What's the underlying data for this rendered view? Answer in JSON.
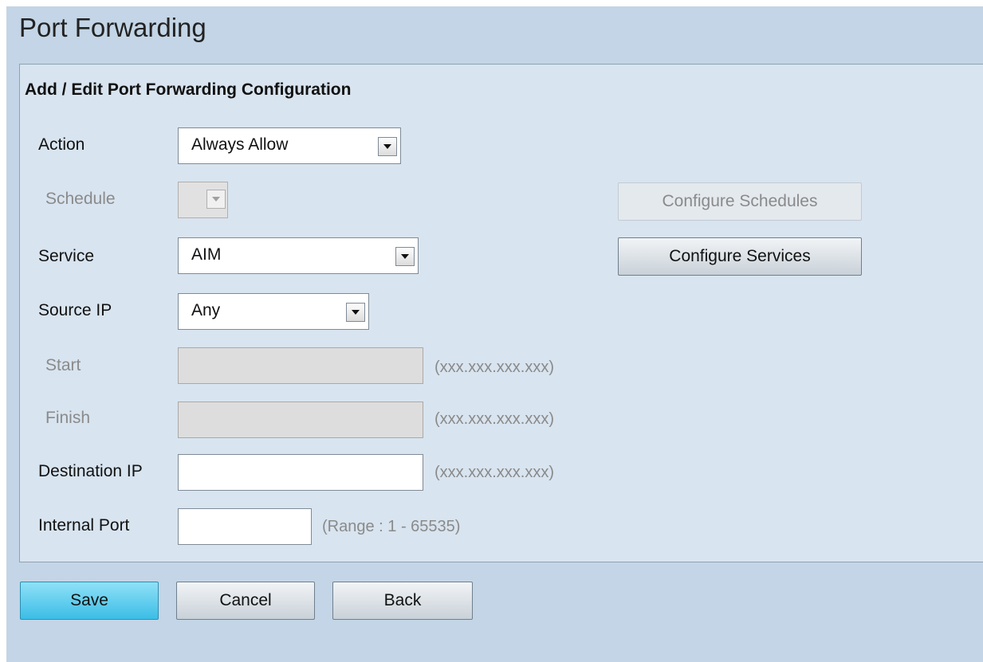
{
  "page": {
    "title": "Port Forwarding"
  },
  "panel": {
    "title": "Add / Edit Port Forwarding Configuration"
  },
  "form": {
    "action": {
      "label": "Action",
      "value": "Always Allow"
    },
    "schedule": {
      "label": "Schedule",
      "value": ""
    },
    "service": {
      "label": "Service",
      "value": "AIM"
    },
    "source_ip": {
      "label": "Source IP",
      "value": "Any"
    },
    "start": {
      "label": "Start",
      "value": "",
      "hint": "(xxx.xxx.xxx.xxx)"
    },
    "finish": {
      "label": "Finish",
      "value": "",
      "hint": "(xxx.xxx.xxx.xxx)"
    },
    "destination_ip": {
      "label": "Destination IP",
      "value": "",
      "hint": "(xxx.xxx.xxx.xxx)"
    },
    "internal_port": {
      "label": "Internal Port",
      "value": "",
      "hint": "(Range : 1 - 65535)"
    }
  },
  "buttons": {
    "configure_schedules": "Configure Schedules",
    "configure_services": "Configure Services",
    "save": "Save",
    "cancel": "Cancel",
    "back": "Back"
  },
  "colors": {
    "page_bg": "#c3d5e6",
    "panel_bg": "#d8e4ef",
    "primary_button": "#3cbde6"
  }
}
